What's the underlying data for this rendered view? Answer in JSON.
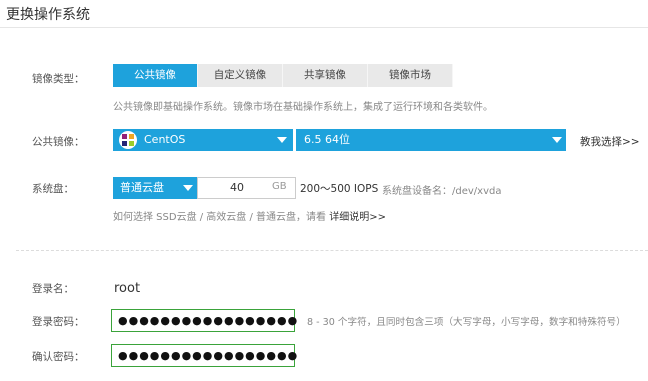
{
  "page_title": "更换操作系统",
  "image_type": {
    "label": "镜像类型：",
    "tabs": [
      "公共镜像",
      "自定义镜像",
      "共享镜像",
      "镜像市场"
    ],
    "active_tab": 0,
    "hint": "公共镜像即基础操作系统。镜像市场在基础操作系统上，集成了运行环境和各类软件。"
  },
  "public_image": {
    "label": "公共镜像：",
    "os_value": "CentOS",
    "os_icon": "centos-logo-icon",
    "version_value": "6.5 64位",
    "help_link": "教我选择>>"
  },
  "system_disk": {
    "label": "系统盘：",
    "type_value": "普通云盘",
    "size_value": "40",
    "size_unit": "GB",
    "iops": "200～500 IOPS",
    "device": "系统盘设备名：/dev/xvda",
    "hint": "如何选择 SSD云盘 / 高效云盘 / 普通云盘，请看",
    "hint_link": "详细说明>>"
  },
  "login": {
    "name_label": "登录名：",
    "name_value": "root",
    "password_label": "登录密码：",
    "password_mask": "●●●●●●●●●●●●●●●●●",
    "password_hint": "8 - 30 个字符，且同时包含三项（大写字母，小写字母，数字和特殊符号）",
    "confirm_label": "确认密码：",
    "confirm_mask": "●●●●●●●●●●●●●●●●●"
  },
  "colors": {
    "accent": "#1ea2dc",
    "input_valid_border": "#3aa33a",
    "tab_inactive": "#e9e9e9"
  }
}
